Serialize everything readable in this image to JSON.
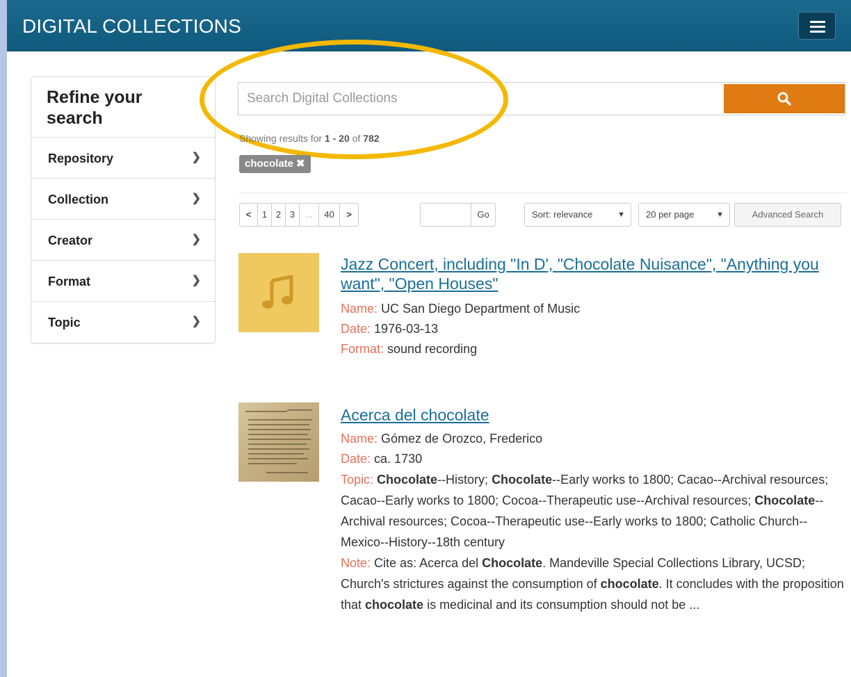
{
  "header": {
    "title": "DIGITAL COLLECTIONS",
    "menu_icon": "hamburger-icon"
  },
  "sidebar": {
    "title": "Refine your search",
    "facets": [
      {
        "label": "Repository"
      },
      {
        "label": "Collection"
      },
      {
        "label": "Creator"
      },
      {
        "label": "Format"
      },
      {
        "label": "Topic"
      }
    ]
  },
  "search": {
    "placeholder": "Search Digital Collections",
    "value": "",
    "button_icon": "search-icon",
    "button_color": "#e07b14"
  },
  "results_summary": {
    "prefix": "Showing results for",
    "range": "1 - 20",
    "of_word": "of",
    "total": "782"
  },
  "active_filter": {
    "label": "chocolate",
    "remove": "✖"
  },
  "pagination": {
    "prev": "<",
    "pages": [
      "1",
      "2",
      "3"
    ],
    "ellipsis": "...",
    "last": "40",
    "next": ">",
    "go_label": "Go"
  },
  "controls": {
    "sort_label": "Sort: relevance",
    "per_page_label": "20 per page",
    "advanced_search": "Advanced Search"
  },
  "results": [
    {
      "title": "Jazz Concert, including \"In D', \"Chocolate Nuisance\", \"Anything you want\", \"Open Houses\"",
      "fields": [
        {
          "key": "Name:",
          "value": "UC San Diego Department of Music"
        },
        {
          "key": "Date:",
          "value": "1976-03-13"
        },
        {
          "key": "Format:",
          "value": "sound recording"
        }
      ],
      "thumbnail": "music-note-icon"
    },
    {
      "title": "Acerca del chocolate",
      "fields": [
        {
          "key": "Name:",
          "value": "Gómez de Orozco, Frederico"
        },
        {
          "key": "Date:",
          "value": "ca. 1730"
        }
      ],
      "topic_key": "Topic:",
      "topic_parts": [
        "Chocolate",
        "--History; ",
        "Chocolate",
        "--Early works to 1800; Cacao--Archival resources; Cacao--Early works to 1800; Cocoa--Therapeutic use--Archival resources; ",
        "Chocolate",
        "--Archival resources; Cocoa--Therapeutic use--Early works to 1800; Catholic Church--Mexico--History--18th century"
      ],
      "note_key": "Note:",
      "note_parts": [
        "Cite as: Acerca del ",
        "Chocolate",
        ". Mandeville Special Collections Library, UCSD; Church's strictures against the consumption of ",
        "chocolate",
        ". It concludes with the proposition that ",
        "chocolate",
        " is medicinal and its consumption should not be ..."
      ],
      "thumbnail": "manuscript-thumbnail"
    }
  ]
}
